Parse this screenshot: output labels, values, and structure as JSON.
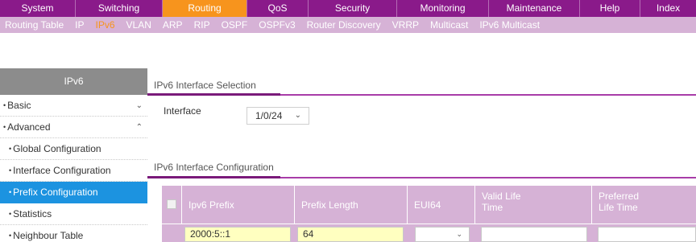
{
  "top_nav": [
    {
      "label": "System",
      "active": false
    },
    {
      "label": "Switching",
      "active": false
    },
    {
      "label": "Routing",
      "active": true
    },
    {
      "label": "QoS",
      "active": false
    },
    {
      "label": "Security",
      "active": false
    },
    {
      "label": "Monitoring",
      "active": false
    },
    {
      "label": "Maintenance",
      "active": false
    },
    {
      "label": "Help",
      "active": false
    },
    {
      "label": "Index",
      "active": false
    }
  ],
  "sub_nav": [
    {
      "label": "Routing Table",
      "active": false
    },
    {
      "label": "IP",
      "active": false
    },
    {
      "label": "IPv6",
      "active": true
    },
    {
      "label": "VLAN",
      "active": false
    },
    {
      "label": "ARP",
      "active": false
    },
    {
      "label": "RIP",
      "active": false
    },
    {
      "label": "OSPF",
      "active": false
    },
    {
      "label": "OSPFv3",
      "active": false
    },
    {
      "label": "Router Discovery",
      "active": false
    },
    {
      "label": "VRRP",
      "active": false
    },
    {
      "label": "Multicast",
      "active": false
    },
    {
      "label": "IPv6 Multicast",
      "active": false
    }
  ],
  "sidebar": {
    "title": "IPv6",
    "items": [
      {
        "label": "Basic"
      },
      {
        "label": "Advanced"
      },
      {
        "label": "Global Configuration"
      },
      {
        "label": "Interface Configuration"
      },
      {
        "label": "Prefix Configuration"
      },
      {
        "label": "Statistics"
      },
      {
        "label": "Neighbour Table"
      }
    ]
  },
  "interface_selection": {
    "title": "IPv6 Interface Selection",
    "label": "Interface",
    "value": "1/0/24"
  },
  "interface_configuration": {
    "title": "IPv6 Interface Configuration",
    "columns": {
      "prefix": "Ipv6 Prefix",
      "length": "Prefix Length",
      "eui": "EUI64",
      "valid_line1": "Valid Life",
      "valid_line2": "Time",
      "preferred_line1": "Preferred",
      "preferred_line2": "Life Time"
    },
    "row": {
      "prefix": "2000:5::1",
      "length": "64",
      "eui": "",
      "valid": "",
      "preferred": ""
    }
  },
  "colors": {
    "nav_bg": "#8a1a8a",
    "active_tab": "#f7941d",
    "subnav_bg": "#d6b2d6",
    "sidebar_active": "#1c93e0"
  }
}
